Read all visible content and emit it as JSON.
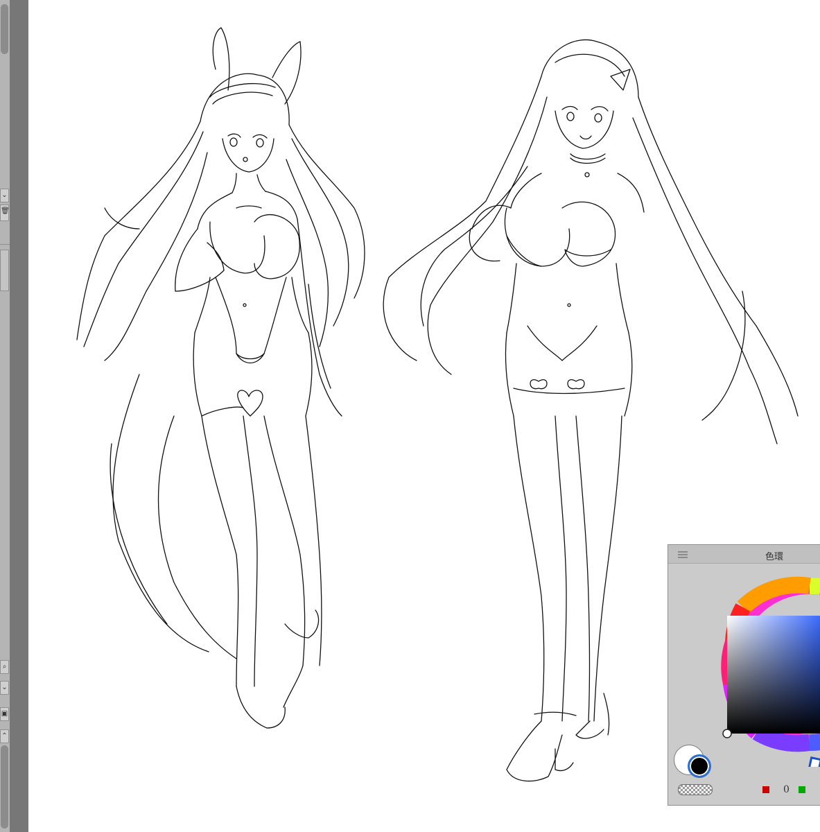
{
  "color_panel": {
    "title": "色環",
    "rgb": [
      {
        "channel": "red",
        "value": "0",
        "color": "#cc0000"
      },
      {
        "channel": "green",
        "value": "",
        "color": "#00aa00"
      }
    ]
  },
  "colors": {
    "foreground": "#000000",
    "background": "#ffffff",
    "selection_ring": "#2f6fd0"
  },
  "left_strip": {
    "icons": [
      "chevron-down-icon",
      "trash-icon",
      "zoom-icon",
      "chevron-down-icon",
      "layer-icon",
      "chevron-up-icon"
    ]
  }
}
